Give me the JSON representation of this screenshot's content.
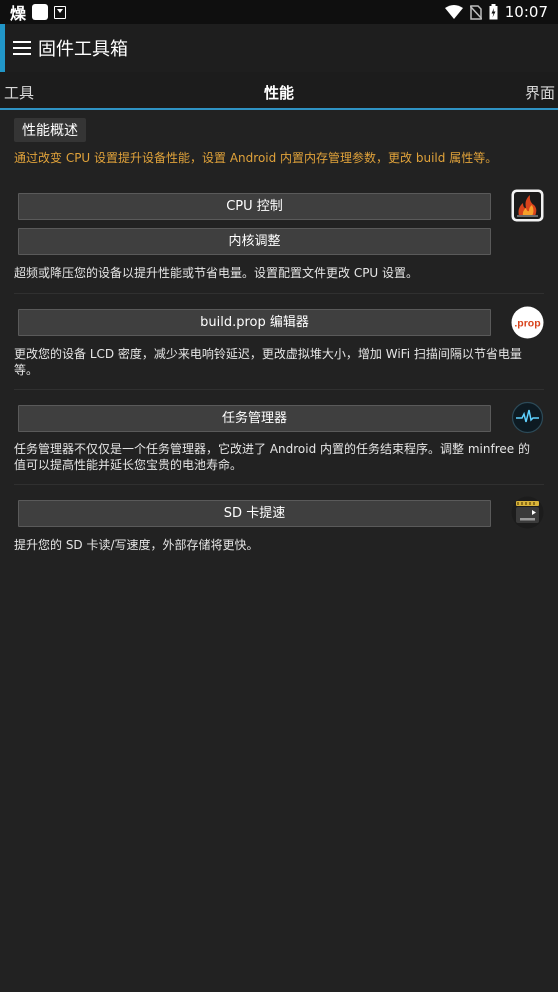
{
  "status_bar": {
    "left_glyph": "燥",
    "time": "10:07",
    "colors": {
      "background": "#0f0f0f",
      "text": "#ffffff"
    }
  },
  "action_bar": {
    "title": "固件工具箱",
    "menu_icon": "menu-icon"
  },
  "tabs": [
    {
      "label": "工具"
    },
    {
      "label": "性能"
    },
    {
      "label": "界面"
    }
  ],
  "overview": {
    "label": "性能概述",
    "description": "通过改变 CPU 设置提升设备性能，设置 Android 内置内存管理参数，更改 build 属性等。"
  },
  "sections": {
    "cpu": {
      "buttons": [
        "CPU 控制",
        "内核调整"
      ],
      "description": "超频或降压您的设备以提升性能或节省电量。设置配置文件更改 CPU 设置。",
      "icon": "cpu-flame-icon"
    },
    "buildprop": {
      "buttons": [
        "build.prop 编辑器"
      ],
      "description_line1": "更改您的设备 LCD 密度，减少来电响铃延迟，更改虚拟堆大小，增加 WiFi 扫描间隔以节省电量",
      "description_line2": "等。",
      "icon": "prop-icon",
      "icon_text": ".prop"
    },
    "taskmanager": {
      "buttons": [
        "任务管理器"
      ],
      "description_line1": "任务管理器不仅仅是一个任务管理器，它改进了 Android 内置的任务结束程序。调整 minfree 的",
      "description_line2": "值可以提高性能并延长您宝贵的电池寿命。",
      "icon": "pulse-monitor-icon"
    },
    "sd": {
      "buttons": [
        "SD 卡提速"
      ],
      "description": "提升您的 SD 卡读/写速度，外部存储将更快。",
      "icon": "sd-card-icon"
    }
  },
  "colors": {
    "accent": "#2f93c4",
    "background": "#222222",
    "highlight_text": "#e0a23a",
    "button_bg": "#3f3f3f"
  }
}
